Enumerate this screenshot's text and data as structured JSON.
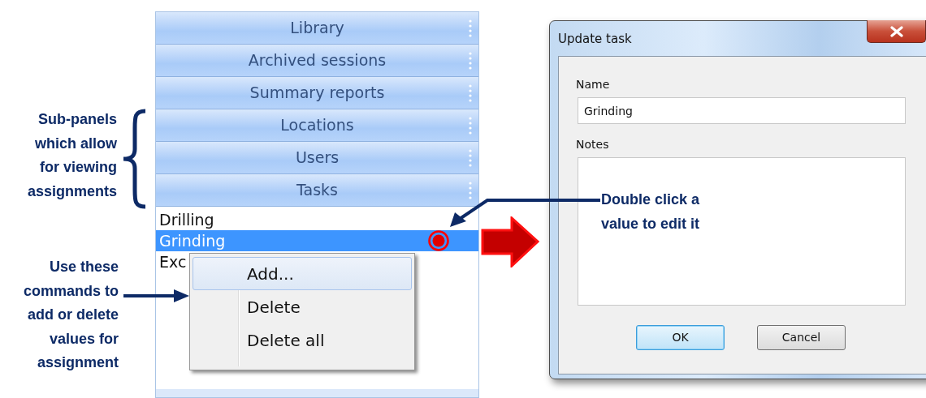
{
  "panel": {
    "sections": [
      {
        "label": "Library"
      },
      {
        "label": "Archived sessions"
      },
      {
        "label": "Summary reports"
      },
      {
        "label": "Locations"
      },
      {
        "label": "Users"
      },
      {
        "label": "Tasks"
      }
    ],
    "items": [
      {
        "label": "Drilling",
        "selected": false
      },
      {
        "label": "Grinding",
        "selected": true
      },
      {
        "label": "Exc",
        "selected": false
      }
    ]
  },
  "context_menu": {
    "items": [
      {
        "label": "Add...",
        "highlighted": true
      },
      {
        "label": "Delete",
        "highlighted": false
      },
      {
        "label": "Delete all",
        "highlighted": false
      }
    ]
  },
  "dialog": {
    "title": "Update task",
    "fields": [
      {
        "label": "Name",
        "kind": "text",
        "value": "Grinding"
      },
      {
        "label": "Notes",
        "kind": "textarea"
      }
    ],
    "buttons": [
      {
        "label": "OK",
        "default": true
      },
      {
        "label": "Cancel",
        "default": false
      }
    ]
  },
  "annotations": [
    {
      "kind": "brace",
      "text": "Sub-panels\nwhich allow\nfor viewing\nassignments"
    },
    {
      "kind": "arrow",
      "text": "Use these\ncommands to\nadd or delete\nvalues for\nassignment"
    },
    {
      "kind": "callout",
      "text": "Double click a\nvalue to edit it"
    }
  ]
}
